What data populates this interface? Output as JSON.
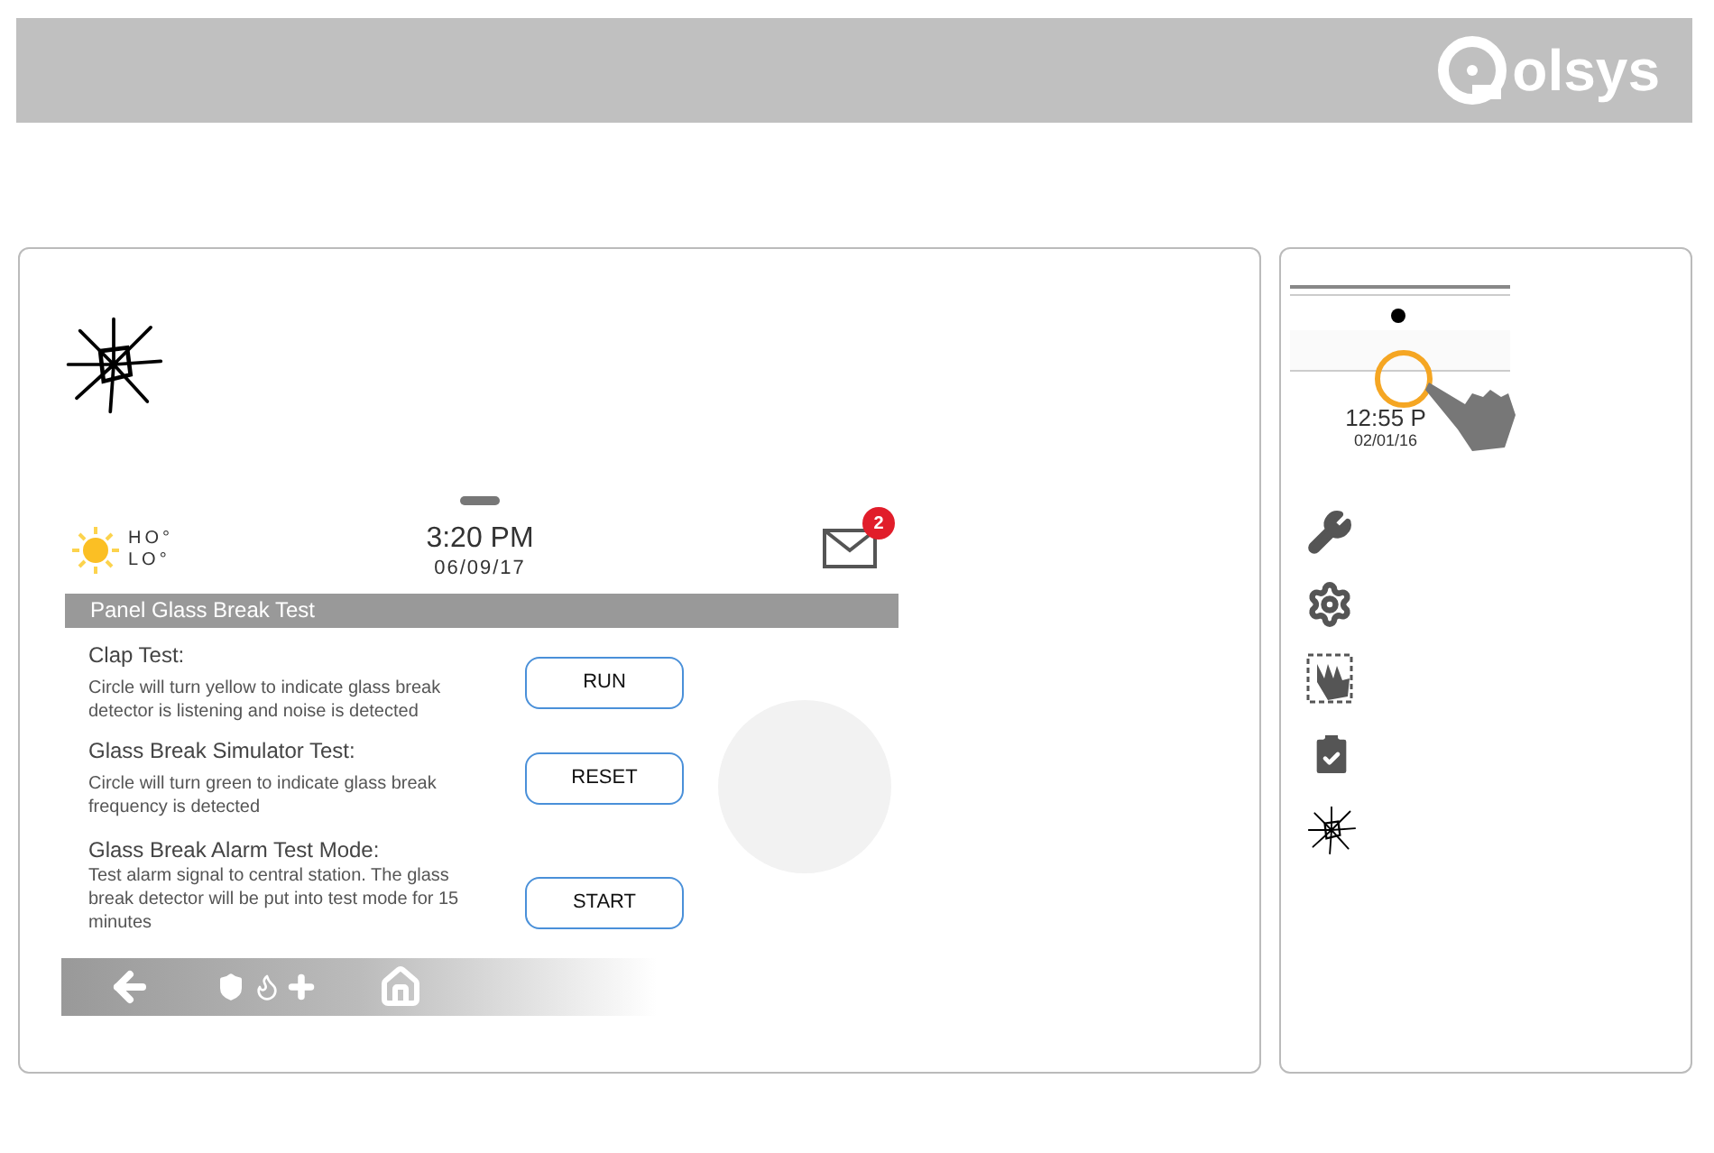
{
  "header": {
    "logo_text": "olsys"
  },
  "screen": {
    "weather": {
      "high": "HO°",
      "low": "LO°"
    },
    "time": "3:20 PM",
    "date": "06/09/17",
    "messages_badge": "2",
    "title": "Panel Glass Break Test",
    "tests": [
      {
        "title": "Clap Test:",
        "description": "Circle will turn yellow to indicate glass break detector is listening and noise is detected",
        "button": "RUN"
      },
      {
        "title": "Glass Break Simulator Test:",
        "description": "Circle will turn green to indicate glass break frequency is detected",
        "button": "RESET"
      },
      {
        "title": "Glass Break Alarm Test Mode:",
        "description": "Test alarm signal to central station. The glass break detector will be put into test mode for 15 minutes",
        "button": "START"
      }
    ]
  },
  "sidebar": {
    "preview": {
      "time": "12:55 P",
      "date": "02/01/16"
    }
  }
}
